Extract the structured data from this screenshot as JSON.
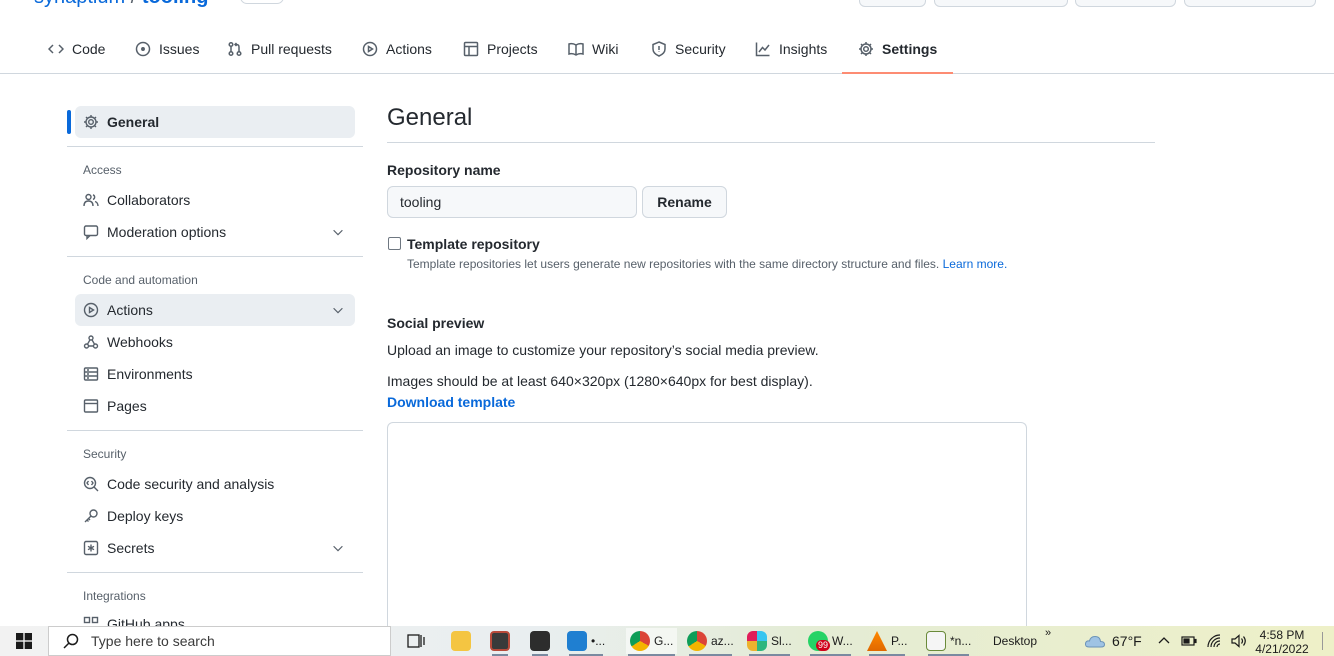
{
  "header": {
    "owner": "synaptium",
    "separator": "/",
    "repo": "tooling"
  },
  "tabs": [
    {
      "label": "Code",
      "icon": "code-icon"
    },
    {
      "label": "Issues",
      "icon": "issue-icon"
    },
    {
      "label": "Pull requests",
      "icon": "pull-request-icon"
    },
    {
      "label": "Actions",
      "icon": "play-icon"
    },
    {
      "label": "Projects",
      "icon": "table-icon"
    },
    {
      "label": "Wiki",
      "icon": "book-icon"
    },
    {
      "label": "Security",
      "icon": "shield-icon"
    },
    {
      "label": "Insights",
      "icon": "graph-icon"
    },
    {
      "label": "Settings",
      "icon": "gear-icon",
      "active": true
    }
  ],
  "sidebar": {
    "general": "General",
    "sections": {
      "access": "Access",
      "code_automation": "Code and automation",
      "security": "Security",
      "integrations": "Integrations"
    },
    "items": {
      "collaborators": "Collaborators",
      "moderation": "Moderation options",
      "actions": "Actions",
      "webhooks": "Webhooks",
      "environments": "Environments",
      "pages": "Pages",
      "code_security": "Code security and analysis",
      "deploy_keys": "Deploy keys",
      "secrets": "Secrets",
      "github_apps": "GitHub apps"
    }
  },
  "main": {
    "title": "General",
    "repo_name_label": "Repository name",
    "repo_name_value": "tooling",
    "rename_button": "Rename",
    "template_label": "Template repository",
    "template_note": "Template repositories let users generate new repositories with the same directory structure and files.",
    "learn_more": "Learn more.",
    "social_preview_label": "Social preview",
    "social_preview_desc": "Upload an image to customize your repository’s social media preview.",
    "image_size_note": "Images should be at least 640×320px (1280×640px for best display).",
    "download_template": "Download template"
  },
  "taskbar": {
    "search_placeholder": "Type here to search",
    "apps": [
      {
        "label": "",
        "icon": "task-view-icon"
      },
      {
        "label": "",
        "icon": "file-explorer-icon"
      },
      {
        "label": "",
        "icon": "snipping-tool-icon"
      },
      {
        "label": "",
        "icon": "terminal-icon"
      },
      {
        "label": "•...",
        "icon": "vscode-icon"
      },
      {
        "label": "G...",
        "icon": "chrome-icon"
      },
      {
        "label": "az...",
        "icon": "chrome-profile-icon"
      },
      {
        "label": "Sl...",
        "icon": "slack-icon"
      },
      {
        "label": "W...",
        "icon": "whatsapp-icon",
        "badge": "99"
      },
      {
        "label": "P...",
        "icon": "vlc-icon"
      },
      {
        "label": "*n...",
        "icon": "notepad-icon"
      }
    ],
    "desktop_label": "Desktop",
    "overflow": "»",
    "weather": "67°F",
    "time": "4:58 PM",
    "date": "4/21/2022"
  },
  "colors": {
    "link": "#0969da",
    "tab_underline": "#fd8c73",
    "selected_bar": "#0969da",
    "border": "#d0d7de",
    "muted_text": "#57606a"
  }
}
